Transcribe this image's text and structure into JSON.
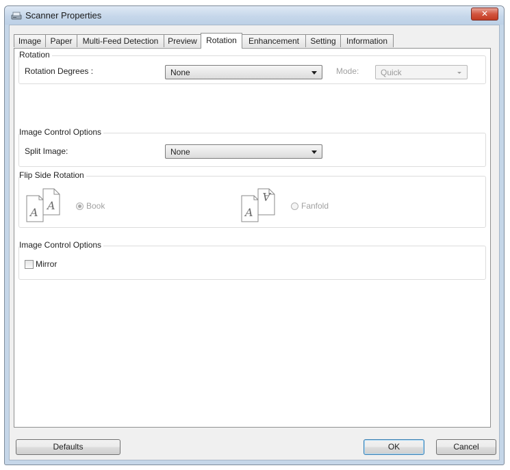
{
  "window": {
    "title": "Scanner Properties",
    "close_glyph": "✕"
  },
  "tabs": [
    {
      "label": "Image"
    },
    {
      "label": "Paper"
    },
    {
      "label": "Multi-Feed Detection"
    },
    {
      "label": "Preview"
    },
    {
      "label": "Rotation",
      "active": true
    },
    {
      "label": "Enhancement"
    },
    {
      "label": "Setting"
    },
    {
      "label": "Information"
    }
  ],
  "rotation": {
    "group_label": "Rotation",
    "degrees_label": "Rotation Degrees :",
    "degrees_value": "None",
    "mode_label": "Mode:",
    "mode_value": "Quick"
  },
  "image_control_1": {
    "group_label": "Image Control Options",
    "split_label": "Split Image:",
    "split_value": "None"
  },
  "flip_side": {
    "group_label": "Flip Side Rotation",
    "book_label": "Book",
    "fanfold_label": "Fanfold",
    "selected": "Book"
  },
  "image_control_2": {
    "group_label": "Image Control Options",
    "mirror_label": "Mirror",
    "mirror_checked": false
  },
  "buttons": {
    "defaults": "Defaults",
    "ok": "OK",
    "cancel": "Cancel"
  }
}
